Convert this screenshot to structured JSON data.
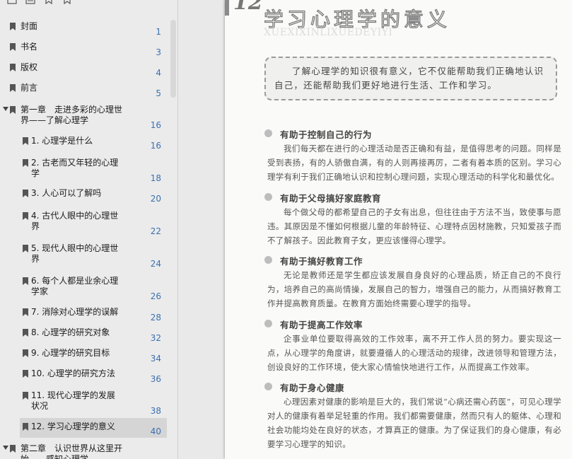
{
  "sidebar": {
    "top_icons": [
      "page-thumbs-icon",
      "outline-icon",
      "bookmark-add-icon",
      "bookmark-icon"
    ],
    "items": [
      {
        "label": "封面",
        "page": "1"
      },
      {
        "label": "书名",
        "page": "3"
      },
      {
        "label": "版权",
        "page": "4"
      },
      {
        "label": "前言",
        "page": "5"
      },
      {
        "label": "第一章　走进多彩的心理世界——了解心理学",
        "page": "16"
      },
      {
        "label": "1. 心理学是什么",
        "page": "16"
      },
      {
        "label": "2. 古老而又年轻的心理学",
        "page": "18"
      },
      {
        "label": "3. 人心可以了解吗",
        "page": "20"
      },
      {
        "label": "4. 古代人眼中的心理世界",
        "page": "22"
      },
      {
        "label": "5. 现代人眼中的心理世界",
        "page": "24"
      },
      {
        "label": "6. 每个人都是业余心理学家",
        "page": "26"
      },
      {
        "label": "7. 消除对心理学的误解",
        "page": "28"
      },
      {
        "label": "8. 心理学的研究对象",
        "page": "32"
      },
      {
        "label": "9. 心理学的研究目标",
        "page": "34"
      },
      {
        "label": "10. 心理学的研究方法",
        "page": "36"
      },
      {
        "label": "11. 现代心理学的发展状况",
        "page": "38"
      },
      {
        "label": "12. 学习心理学的意义",
        "page": "40"
      },
      {
        "label": "第二章　认识世界从这里开始——感知心理学",
        "page": ""
      }
    ]
  },
  "page": {
    "chapter_number": "12",
    "title": "学习心理学的意义",
    "pinyin": "XUEXIXINLIXUEDEYIYI",
    "intro": "了解心理学的知识很有意义，它不仅能帮助我们正确地认识自己，还能帮助我们更好地进行生活、工作和学习。",
    "sections": [
      {
        "heading": "有助于控制自己的行为",
        "body": "我们每天都在进行的心理活动是否正确和有益，是值得思考的问题。同样是受到表扬，有的人骄傲自满，有的人则再接再厉，二者有着本质的区别。学习心理学有利于我们正确地认识和控制心理问题，实现心理活动的科学化和最优化。"
      },
      {
        "heading": "有助于父母搞好家庭教育",
        "body": "每个做父母的都希望自己的子女有出息，但往往由于方法不当，致使事与愿违。其原因是不懂如何根据儿童的年龄特征、心理特点因材施教，只知爱孩子而不了解孩子。因此教育子女，更应该懂得心理学。"
      },
      {
        "heading": "有助于搞好教育工作",
        "body": "无论是教师还是学生都应该发展自身良好的心理品质，矫正自己的不良行为，培养自己的高尚情操，发展自己的智力，增强自己的能力，从而搞好教育工作并提高教育质量。在教育方面始终需要心理学的指导。"
      },
      {
        "heading": "有助于提高工作效率",
        "body": "企事业单位要取得高效的工作效率，离不开工作人员的努力。要实现这一点，从心理学的角度讲，就要遵循人的心理活动的规律，改进领导和管理方法，创设良好的工作环境，使大家心情愉快地进行工作，从而提高工作效率。"
      },
      {
        "heading": "有助于身心健康",
        "body": "心理因素对健康的影响是巨大的，我们常说“心病还需心药医”，可见心理学对人的健康有着举足轻重的作用。我们都需要健康，然而只有人的躯体、心理和社会功能均处在良好的状态，才算真正的健康。为了保证我们的身心健康，有必要学习心理学的知识。"
      }
    ]
  }
}
